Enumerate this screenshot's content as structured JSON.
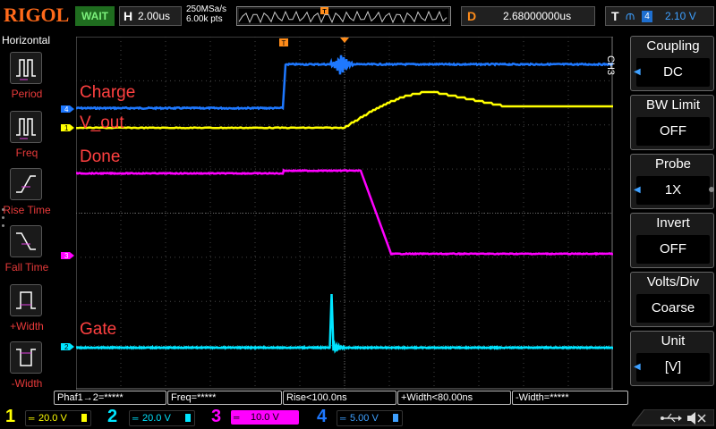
{
  "top": {
    "brand": "RIGOL",
    "run_state": "WAIT",
    "horizontal_label": "H",
    "timebase": "2.00us",
    "sample_rate": "250MSa/s",
    "memory_depth": "6.00k pts",
    "delay_label": "D",
    "delay_value": "2.68000000us",
    "trigger_label": "T",
    "trigger_source": "4",
    "trigger_level": "2.10 V"
  },
  "left_panel": {
    "title": "Horizontal",
    "items": [
      {
        "label": "Period",
        "icon": "period-icon"
      },
      {
        "label": "Freq",
        "icon": "freq-icon"
      },
      {
        "label": "Rise Time",
        "icon": "rise-time-icon"
      },
      {
        "label": "Fall Time",
        "icon": "fall-time-icon"
      },
      {
        "label": "+Width",
        "icon": "pos-width-icon"
      },
      {
        "label": "-Width",
        "icon": "neg-width-icon"
      }
    ]
  },
  "traces": {
    "labels": {
      "charge": "Charge",
      "vout": "V_out",
      "done": "Done",
      "gate": "Gate"
    },
    "label_color": "#ff4040",
    "markers": {
      "ch4": "4",
      "ch1": "1",
      "ch3": "3",
      "ch2": "2",
      "trigger": "T"
    },
    "colors": {
      "ch1": "#ffff00",
      "ch2": "#00e5ff",
      "ch3": "#ff00ff",
      "ch4": "#1e78ff",
      "trigger": "#ff8c1a"
    }
  },
  "right_menu": {
    "channel_tag": "CH3",
    "items": [
      {
        "title": "Coupling",
        "value": "DC",
        "has_arrow": true
      },
      {
        "title": "BW Limit",
        "value": "OFF",
        "has_arrow": false
      },
      {
        "title": "Probe",
        "value": "1X",
        "has_arrow": true
      },
      {
        "title": "Invert",
        "value": "OFF",
        "has_arrow": false
      },
      {
        "title": "Volts/Div",
        "value": "Coarse",
        "has_arrow": false
      },
      {
        "title": "Unit",
        "value": "[V]",
        "has_arrow": true
      }
    ]
  },
  "measurements": [
    {
      "text": "Phaf1→2=*****"
    },
    {
      "text": "Freq=*****"
    },
    {
      "text": "Rise<100.0ns"
    },
    {
      "text": "+Width<80.00ns"
    },
    {
      "text": "-Width=*****"
    }
  ],
  "channels": [
    {
      "num": "1",
      "coupling": "═",
      "scale": "20.0 V",
      "color": "#ffff00",
      "active": false
    },
    {
      "num": "2",
      "coupling": "═",
      "scale": "20.0 V",
      "color": "#00e5ff",
      "active": false
    },
    {
      "num": "3",
      "coupling": "═",
      "scale": "10.0 V",
      "color": "#ff00ff",
      "active": true
    },
    {
      "num": "4",
      "coupling": "═",
      "scale": "5.00 V",
      "color": "#1e78ff",
      "active": false
    }
  ],
  "status_icons": [
    "usb-icon",
    "mute-icon"
  ]
}
